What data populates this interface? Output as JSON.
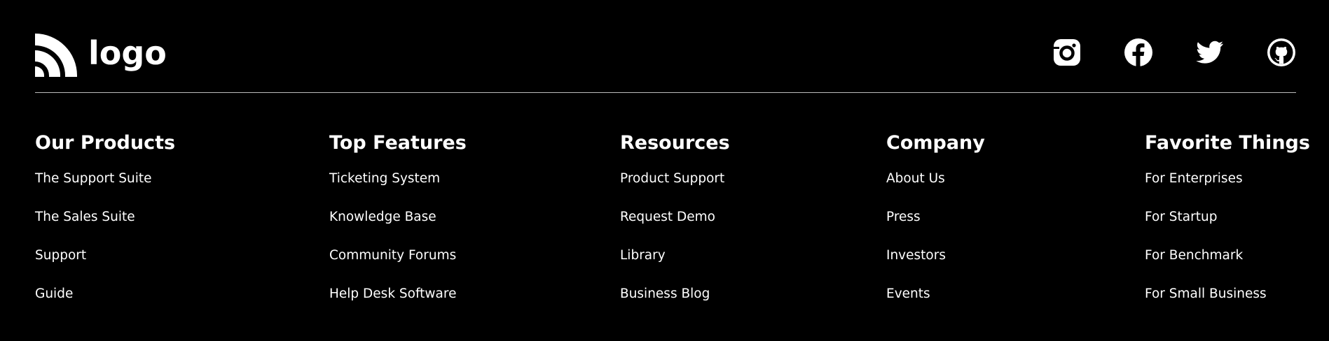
{
  "logo": {
    "text": "logo"
  },
  "social": [
    {
      "icon": "instagram-icon",
      "label": "Instagram"
    },
    {
      "icon": "facebook-icon",
      "label": "Facebook"
    },
    {
      "icon": "twitter-icon",
      "label": "Twitter"
    },
    {
      "icon": "github-icon",
      "label": "GitHub"
    }
  ],
  "columns": [
    {
      "title": "Our Products",
      "links": [
        "The Support Suite",
        "The Sales Suite",
        "Support",
        "Guide"
      ]
    },
    {
      "title": "Top Features",
      "links": [
        "Ticketing System",
        "Knowledge Base",
        "Community Forums",
        "Help Desk Software"
      ]
    },
    {
      "title": "Resources",
      "links": [
        "Product Support",
        "Request Demo",
        "Library",
        "Business Blog"
      ]
    },
    {
      "title": "Company",
      "links": [
        "About Us",
        "Press",
        "Investors",
        "Events"
      ]
    },
    {
      "title": "Favorite Things",
      "links": [
        "For Enterprises",
        "For Startup",
        "For Benchmark",
        "For Small Business"
      ]
    }
  ],
  "colors": {
    "background": "#000000",
    "text": "#ffffff",
    "divider": "#bdbdbd"
  }
}
